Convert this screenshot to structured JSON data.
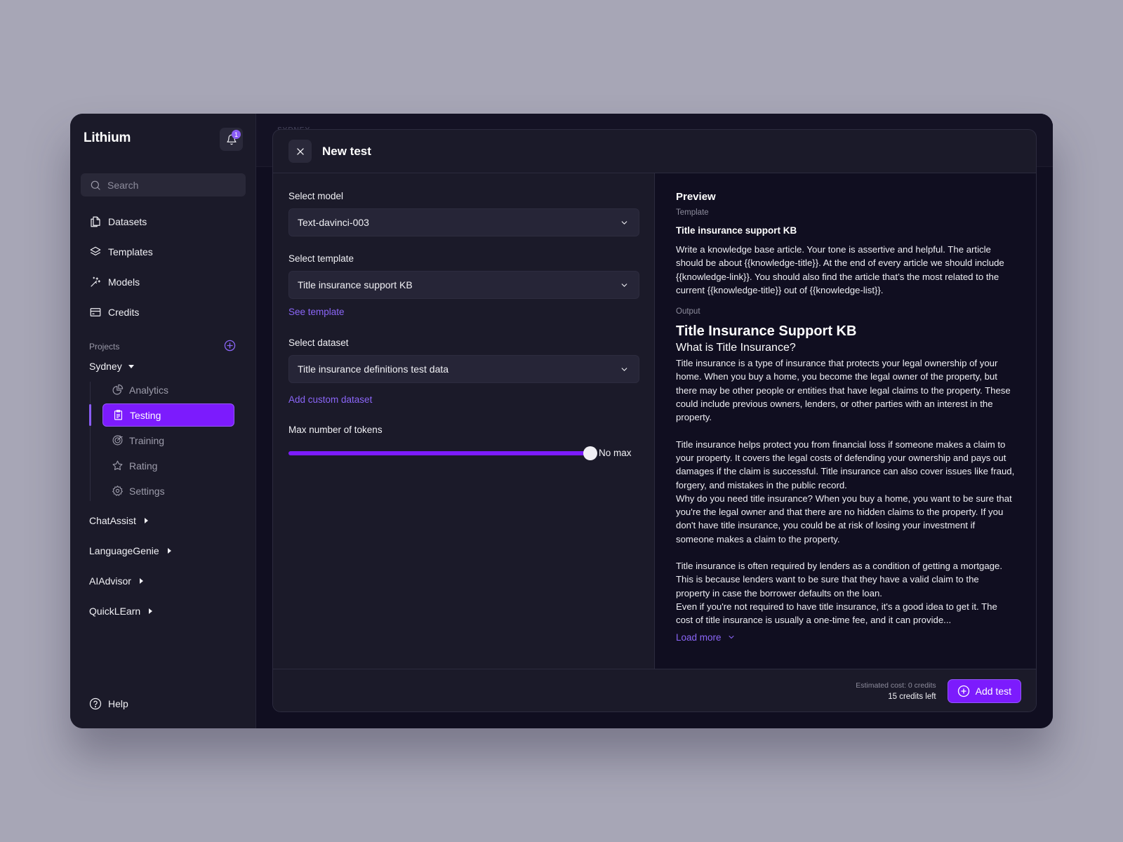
{
  "app": {
    "title": "Lithium",
    "notifications_count": "1"
  },
  "sidebar": {
    "search_placeholder": "Search",
    "nav": [
      {
        "label": "Datasets",
        "icon": "copy-icon"
      },
      {
        "label": "Templates",
        "icon": "layers-icon"
      },
      {
        "label": "Models",
        "icon": "magic-wand-icon"
      },
      {
        "label": "Credits",
        "icon": "credit-card-icon"
      }
    ],
    "projects_label": "Projects",
    "active_project": {
      "name": "Sydney",
      "expanded": true,
      "items": [
        {
          "label": "Analytics",
          "icon": "pie-chart-icon",
          "active": false
        },
        {
          "label": "Testing",
          "icon": "clipboard-icon",
          "active": true
        },
        {
          "label": "Training",
          "icon": "target-icon",
          "active": false
        },
        {
          "label": "Rating",
          "icon": "star-icon",
          "active": false
        },
        {
          "label": "Settings",
          "icon": "gear-icon",
          "active": false
        }
      ]
    },
    "other_projects": [
      {
        "name": "ChatAssist"
      },
      {
        "name": "LanguageGenie"
      },
      {
        "name": "AIAdvisor"
      },
      {
        "name": "QuickLEarn"
      }
    ],
    "help_label": "Help"
  },
  "background": {
    "breadcrumb": "SYDNEY"
  },
  "modal": {
    "title": "New test",
    "form": {
      "model_label": "Select model",
      "model_value": "Text-davinci-003",
      "template_label": "Select template",
      "template_value": "Title insurance support KB",
      "see_template_link": "See template",
      "dataset_label": "Select dataset",
      "dataset_value": "Title insurance definitions test data",
      "add_dataset_link": "Add custom dataset",
      "tokens_label": "Max number of tokens",
      "tokens_slider_fraction": 1.0,
      "tokens_value": "No max"
    },
    "preview": {
      "title": "Preview",
      "template_label": "Template",
      "template_name": "Title insurance support KB",
      "template_body": "Write a knowledge base article. Your tone is assertive and helpful. The article should be about {{knowledge-title}}. At the end of every article we should include {{knowledge-link}}. You should also find the article that’s the most related to the current {{knowledge-title}} out of {{knowledge-list}}.",
      "output_label": "Output",
      "output_title": "Title Insurance Support KB",
      "output_subtitle": "What is Title Insurance?",
      "output_paragraphs": [
        "Title insurance is a type of insurance that protects your legal ownership of your home. When you buy a home, you become the legal owner of the property, but there may be other people or entities that have legal claims to the property. These could include previous owners, lenders, or other parties with an interest in the property.",
        "Title insurance helps protect you from financial loss if someone makes a claim to your property. It covers the legal costs of defending your ownership and pays out damages if the claim is successful. Title insurance can also cover issues like fraud, forgery, and mistakes in the public record.",
        "Why do you need title insurance? When you buy a home, you want to be sure that you're the legal owner and that there are no hidden claims to the property. If you don't have title insurance, you could be at risk of losing your investment if someone makes a claim to the property.",
        "Title insurance is often required by lenders as a condition of getting a mortgage. This is because lenders want to be sure that they have a valid claim to the property in case the borrower defaults on the loan.",
        "Even if you're not required to have title insurance, it's a good idea to get it. The cost of title insurance is usually a one-time fee, and it can provide..."
      ],
      "load_more_label": "Load more"
    },
    "footer": {
      "estimated_cost": "Estimated cost: 0 credits",
      "credits_left": "15 credits left",
      "add_button_label": "Add test"
    }
  },
  "colors": {
    "accent": "#7c1bfd",
    "link": "#8b66f8",
    "sidebar_bg": "#1b1a29",
    "app_bg": "#100e20",
    "page_bg": "#a7a6b6"
  }
}
